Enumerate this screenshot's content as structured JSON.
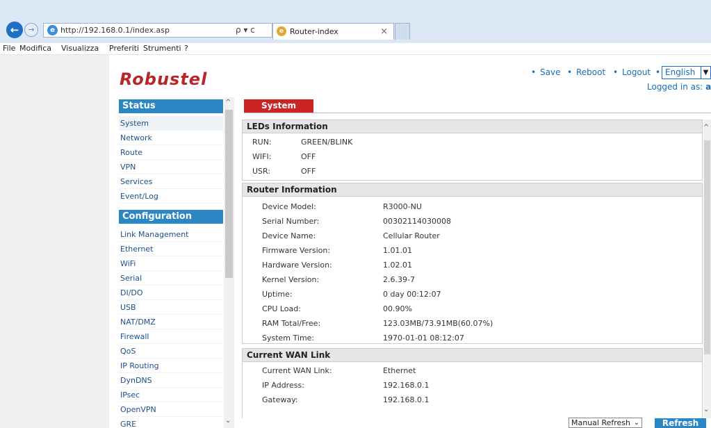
{
  "browser": {
    "url": "http://192.168.0.1/index.asp",
    "search_control": "ρ ▾ c",
    "tab_title": "Router-index",
    "tab_close": "×",
    "menu": [
      "File",
      "Modifica",
      "Visualizza",
      "Preferiti",
      "Strumenti",
      "?"
    ]
  },
  "header": {
    "logo": "Robustel",
    "links": [
      "Save",
      "Reboot",
      "Logout"
    ],
    "language": "English",
    "logged_in_label": "Logged in as:",
    "logged_in_user": "admi"
  },
  "sidebar": {
    "status_title": "Status",
    "status_items": [
      "System",
      "Network",
      "Route",
      "VPN",
      "Services",
      "Event/Log"
    ],
    "config_title": "Configuration",
    "config_items": [
      "Link Management",
      "Ethernet",
      "WiFi",
      "Serial",
      "DI/DO",
      "USB",
      "NAT/DMZ",
      "Firewall",
      "QoS",
      "IP Routing",
      "DynDNS",
      "IPsec",
      "OpenVPN",
      "GRE"
    ]
  },
  "main": {
    "active_tab": "System",
    "leds": {
      "title": "LEDs Information",
      "rows": [
        {
          "label": "RUN:",
          "value": "GREEN/BLINK"
        },
        {
          "label": "WIFI:",
          "value": "OFF"
        },
        {
          "label": "USR:",
          "value": "OFF"
        }
      ]
    },
    "router": {
      "title": "Router Information",
      "rows": [
        {
          "label": "Device Model:",
          "value": "R3000-NU"
        },
        {
          "label": "Serial Number:",
          "value": "00302114030008"
        },
        {
          "label": "Device Name:",
          "value": "Cellular Router"
        },
        {
          "label": "Firmware Version:",
          "value": "1.01.01"
        },
        {
          "label": "Hardware Version:",
          "value": "1.02.01"
        },
        {
          "label": "Kernel Version:",
          "value": "2.6.39-7"
        },
        {
          "label": "Uptime:",
          "value": "0 day 00:12:07"
        },
        {
          "label": "CPU Load:",
          "value": "00.90%"
        },
        {
          "label": "RAM Total/Free:",
          "value": "123.03MB/73.91MB(60.07%)"
        },
        {
          "label": "System Time:",
          "value": "1970-01-01 08:12:07"
        }
      ]
    },
    "wan": {
      "title": "Current WAN Link",
      "rows": [
        {
          "label": "Current WAN Link:",
          "value": "Ethernet"
        },
        {
          "label": "IP Address:",
          "value": "192.168.0.1"
        },
        {
          "label": "Gateway:",
          "value": "192.168.0.1"
        }
      ]
    }
  },
  "footer": {
    "refresh_mode": "Manual Refresh",
    "refresh_button": "Refresh"
  }
}
